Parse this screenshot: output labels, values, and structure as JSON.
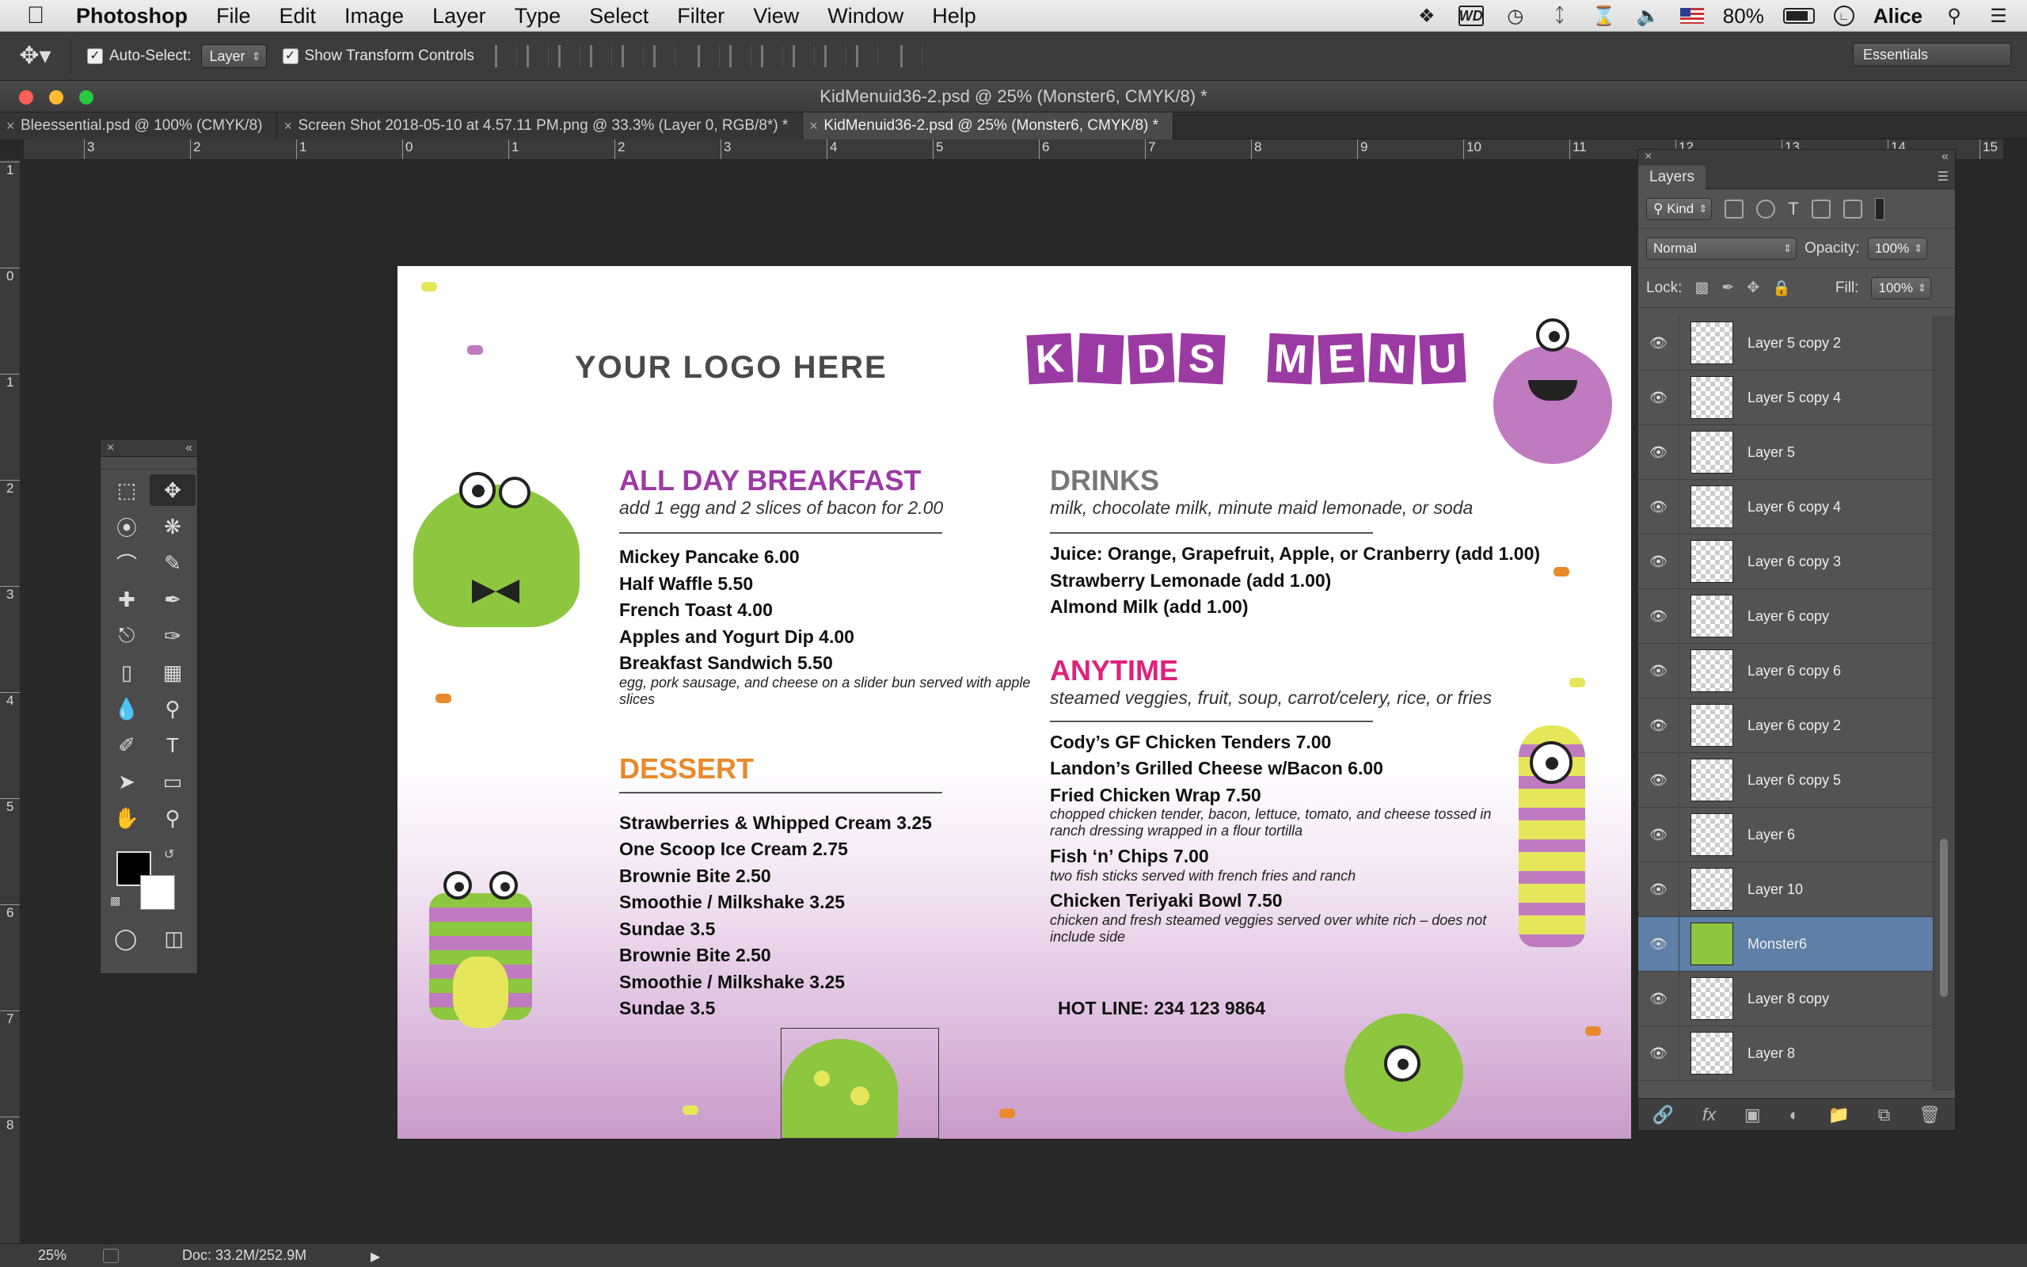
{
  "menubar": {
    "app_name": "Photoshop",
    "menus": [
      "File",
      "Edit",
      "Image",
      "Layer",
      "Type",
      "Select",
      "Filter",
      "View",
      "Window",
      "Help"
    ],
    "battery_label": "80%",
    "user": "Alice"
  },
  "options_bar": {
    "auto_select_label": "Auto-Select:",
    "auto_select_value": "Layer",
    "show_transform_label": "Show Transform Controls",
    "workspace": "Essentials"
  },
  "document": {
    "window_title": "KidMenuid36-2.psd @ 25% (Monster6, CMYK/8) *",
    "tabs": [
      {
        "label": "Bleessential.psd @ 100% (CMYK/8)"
      },
      {
        "label": "Screen Shot 2018-05-10 at 4.57.11 PM.png @ 33.3% (Layer 0, RGB/8*) *"
      },
      {
        "label": "KidMenuid36-2.psd @ 25% (Monster6, CMYK/8) *"
      }
    ],
    "ruler_top": [
      "3",
      "2",
      "1",
      "0",
      "1",
      "2",
      "3",
      "4",
      "5",
      "6",
      "7",
      "8",
      "9",
      "10",
      "11",
      "12",
      "13",
      "14",
      "15"
    ],
    "ruler_left": [
      "1",
      "0",
      "1",
      "2",
      "3",
      "4",
      "5",
      "6",
      "7",
      "8"
    ]
  },
  "menu": {
    "logo": "YOUR LOGO HERE",
    "kids_word": [
      "K",
      "I",
      "D",
      "S"
    ],
    "menu_word": [
      "M",
      "E",
      "N",
      "U"
    ],
    "breakfast": {
      "title": "ALL DAY BREAKFAST",
      "subtitle": "add 1 egg and 2 slices of bacon for 2.00",
      "items": [
        "Mickey Pancake  6.00",
        "Half Waffle  5.50",
        "French Toast  4.00",
        "Apples and Yogurt Dip  4.00",
        "Breakfast Sandwich  5.50"
      ],
      "sandwich_desc": "egg, pork sausage, and cheese on a slider bun served with apple slices"
    },
    "dessert": {
      "title": "DESSERT",
      "items": [
        "Strawberries & Whipped Cream  3.25",
        "One Scoop Ice Cream  2.75",
        "Brownie Bite  2.50",
        "Smoothie / Milkshake  3.25",
        "Sundae 3.5",
        "Brownie Bite  2.50",
        "Smoothie / Milkshake  3.25",
        "Sundae 3.5"
      ]
    },
    "drinks": {
      "title": "DRINKS",
      "subtitle": "milk, chocolate milk, minute maid lemonade, or soda",
      "items": [
        "Juice: Orange, Grapefruit, Apple, or Cranberry  (add 1.00)",
        "Strawberry Lemonade (add 1.00)",
        "Almond Milk (add 1.00)"
      ]
    },
    "anytime": {
      "title": "ANYTIME",
      "subtitle": "steamed veggies, fruit, soup, carrot/celery, rice, or fries",
      "items": [
        {
          "name": "Cody’s GF Chicken Tenders 7.00",
          "desc": ""
        },
        {
          "name": "Landon’s Grilled Cheese w/Bacon 6.00",
          "desc": ""
        },
        {
          "name": "Fried Chicken Wrap  7.50",
          "desc": "chopped chicken tender, bacon, lettuce, tomato, and cheese tossed in ranch dressing wrapped in a flour tortilla"
        },
        {
          "name": "Fish ‘n’ Chips  7.00",
          "desc": "two fish sticks served with french fries and ranch"
        },
        {
          "name": "Chicken Teriyaki Bowl 7.50",
          "desc": "chicken and fresh steamed veggies served over white rich – does not include side"
        }
      ]
    },
    "hotline": "HOT LINE: 234 123 9864"
  },
  "layers_panel": {
    "title": "Layers",
    "filter_kind": "Kind",
    "blend_mode": "Normal",
    "opacity_label": "Opacity:",
    "opacity_value": "100%",
    "lock_label": "Lock:",
    "fill_label": "Fill:",
    "fill_value": "100%",
    "layers": [
      {
        "name": "Layer 5 copy 2",
        "selected": false
      },
      {
        "name": "Layer 5 copy 4",
        "selected": false
      },
      {
        "name": "Layer 5",
        "selected": false
      },
      {
        "name": "Layer 6 copy 4",
        "selected": false
      },
      {
        "name": "Layer 6 copy 3",
        "selected": false
      },
      {
        "name": "Layer 6 copy",
        "selected": false
      },
      {
        "name": "Layer 6 copy 6",
        "selected": false
      },
      {
        "name": "Layer 6 copy 2",
        "selected": false
      },
      {
        "name": "Layer 6 copy 5",
        "selected": false
      },
      {
        "name": "Layer 6",
        "selected": false
      },
      {
        "name": "Layer 10",
        "selected": false
      },
      {
        "name": "Monster6",
        "selected": true
      },
      {
        "name": "Layer 8 copy",
        "selected": false
      },
      {
        "name": "Layer 8",
        "selected": false
      }
    ]
  },
  "status_bar": {
    "zoom": "25%",
    "doc_info": "Doc: 33.2M/252.9M"
  },
  "colors": {
    "purple": "#9c3aa3",
    "orange": "#e8892b",
    "pink": "#e0217b",
    "gray_title": "#777777",
    "monster_green": "#8dc63f"
  }
}
